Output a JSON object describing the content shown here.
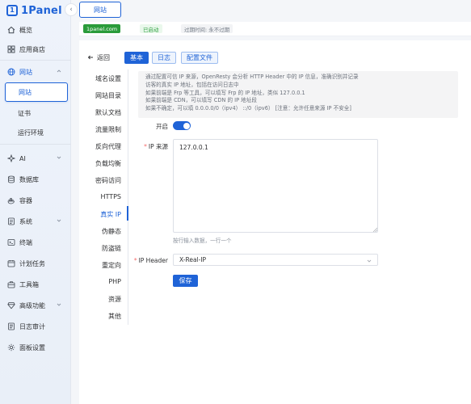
{
  "app": {
    "logo_text": "1Panel",
    "logo_mark": "1"
  },
  "sidebar": {
    "items": [
      {
        "label": "概览",
        "icon": "home-icon"
      },
      {
        "label": "应用商店",
        "icon": "app-store-icon"
      },
      {
        "label": "网站",
        "icon": "globe-icon"
      },
      {
        "label": "AI",
        "icon": "ai-icon"
      },
      {
        "label": "数据库",
        "icon": "database-icon"
      },
      {
        "label": "容器",
        "icon": "container-icon"
      },
      {
        "label": "系统",
        "icon": "system-icon"
      },
      {
        "label": "终端",
        "icon": "terminal-icon"
      },
      {
        "label": "计划任务",
        "icon": "schedule-icon"
      },
      {
        "label": "工具箱",
        "icon": "toolbox-icon"
      },
      {
        "label": "高级功能",
        "icon": "advanced-icon"
      },
      {
        "label": "日志审计",
        "icon": "log-icon"
      },
      {
        "label": "面板设置",
        "icon": "settings-icon"
      }
    ],
    "website_sub": [
      "网站",
      "证书",
      "运行环境"
    ]
  },
  "topbar": {
    "tab_label": "网站"
  },
  "site": {
    "domain": "1panel.com",
    "status": "已启动",
    "expire": "过期时间: 永不过期"
  },
  "toolbar": {
    "back_label": "返回",
    "tabs": [
      "基本",
      "日志",
      "配置文件"
    ]
  },
  "side_menu": [
    "域名设置",
    "网站目录",
    "默认文档",
    "流量限制",
    "反向代理",
    "负载均衡",
    "密码访问",
    "HTTPS",
    "真实 IP",
    "伪静态",
    "防盗链",
    "重定向",
    "PHP",
    "资源",
    "其他"
  ],
  "notice": {
    "lines": [
      "通过配置可信 IP 来源，OpenResty 会分析 HTTP Header 中的 IP 信息，准确识别并记录",
      "访客的真实 IP 地址，包括在访问日志中",
      "如果前端是 Frp 等工具，可以填写 Frp 的 IP 地址，类似 127.0.0.1",
      "如果前端是 CDN，可以填写 CDN 的 IP 地址段",
      "如果不确定，可以填 0.0.0.0/0（ipv4） ::/0（ipv6） [注意：允许任意来源 IP 不安全]"
    ]
  },
  "form": {
    "enable_label": "开启",
    "enabled": true,
    "ip_source_label": "IP 来源",
    "ip_source_value": "127.0.0.1",
    "ip_source_hint": "按行输入数据，一行一个",
    "ip_header_label": "IP Header",
    "ip_header_value": "X-Real-IP",
    "save_label": "保存"
  },
  "colors": {
    "primary": "#1f63d7",
    "success": "#2a9b3a",
    "required": "#f56c6c"
  }
}
